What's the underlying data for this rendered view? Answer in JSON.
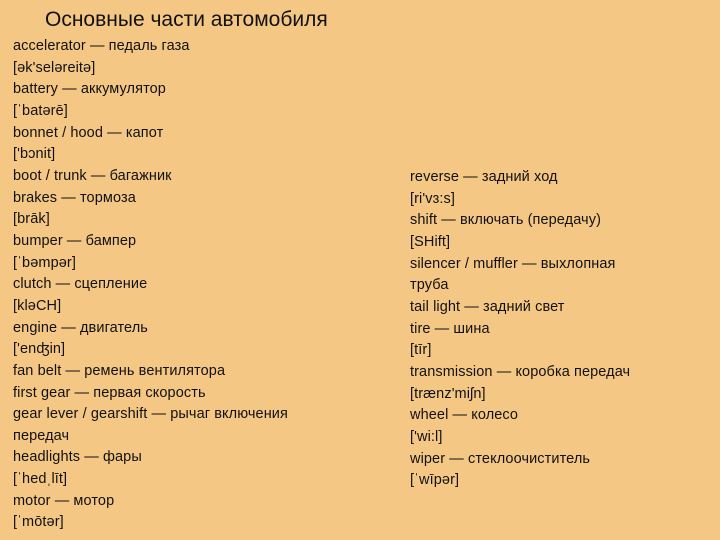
{
  "title": "Основные части автомобиля",
  "left_column": [
    "accelerator — педаль газа",
    "[ək'seləreitə]",
    "battery — аккумулятор",
    "[ˈbatərē]",
    "bonnet / hood — капот",
    "['bɔnit]",
    "boot / trunk — багажник",
    "brakes — тормоза",
    "[brāk]",
    "bumper — бампер",
    "[ˈbəmpər]",
    "clutch — сцепление",
    "[kləCH]",
    "engine — двигатель",
    "['enʤin]",
    "fan belt — ремень вентилятора",
    "first gear — первая скорость",
    "gear lever / gearshift — рычаг включения",
    "передач",
    "headlights — фары",
    "[ˈhedˌlīt]",
    "motor — мотор",
    "[ˈmōtər]"
  ],
  "right_column": [
    "reverse — задний ход",
    "[ri'vɜ:s]",
    "shift — включать (передачу)",
    "[SHift]",
    "silencer / muffler — выхлопная",
    "труба",
    "tail light — задний свет",
    "tire — шина",
    "[tīr]",
    "transmission — коробка передач",
    "[trænz'miʃn]",
    "wheel — колесо",
    "['wi:l]",
    "wiper — стеклоочиститель",
    "[ˈwīpər]"
  ]
}
